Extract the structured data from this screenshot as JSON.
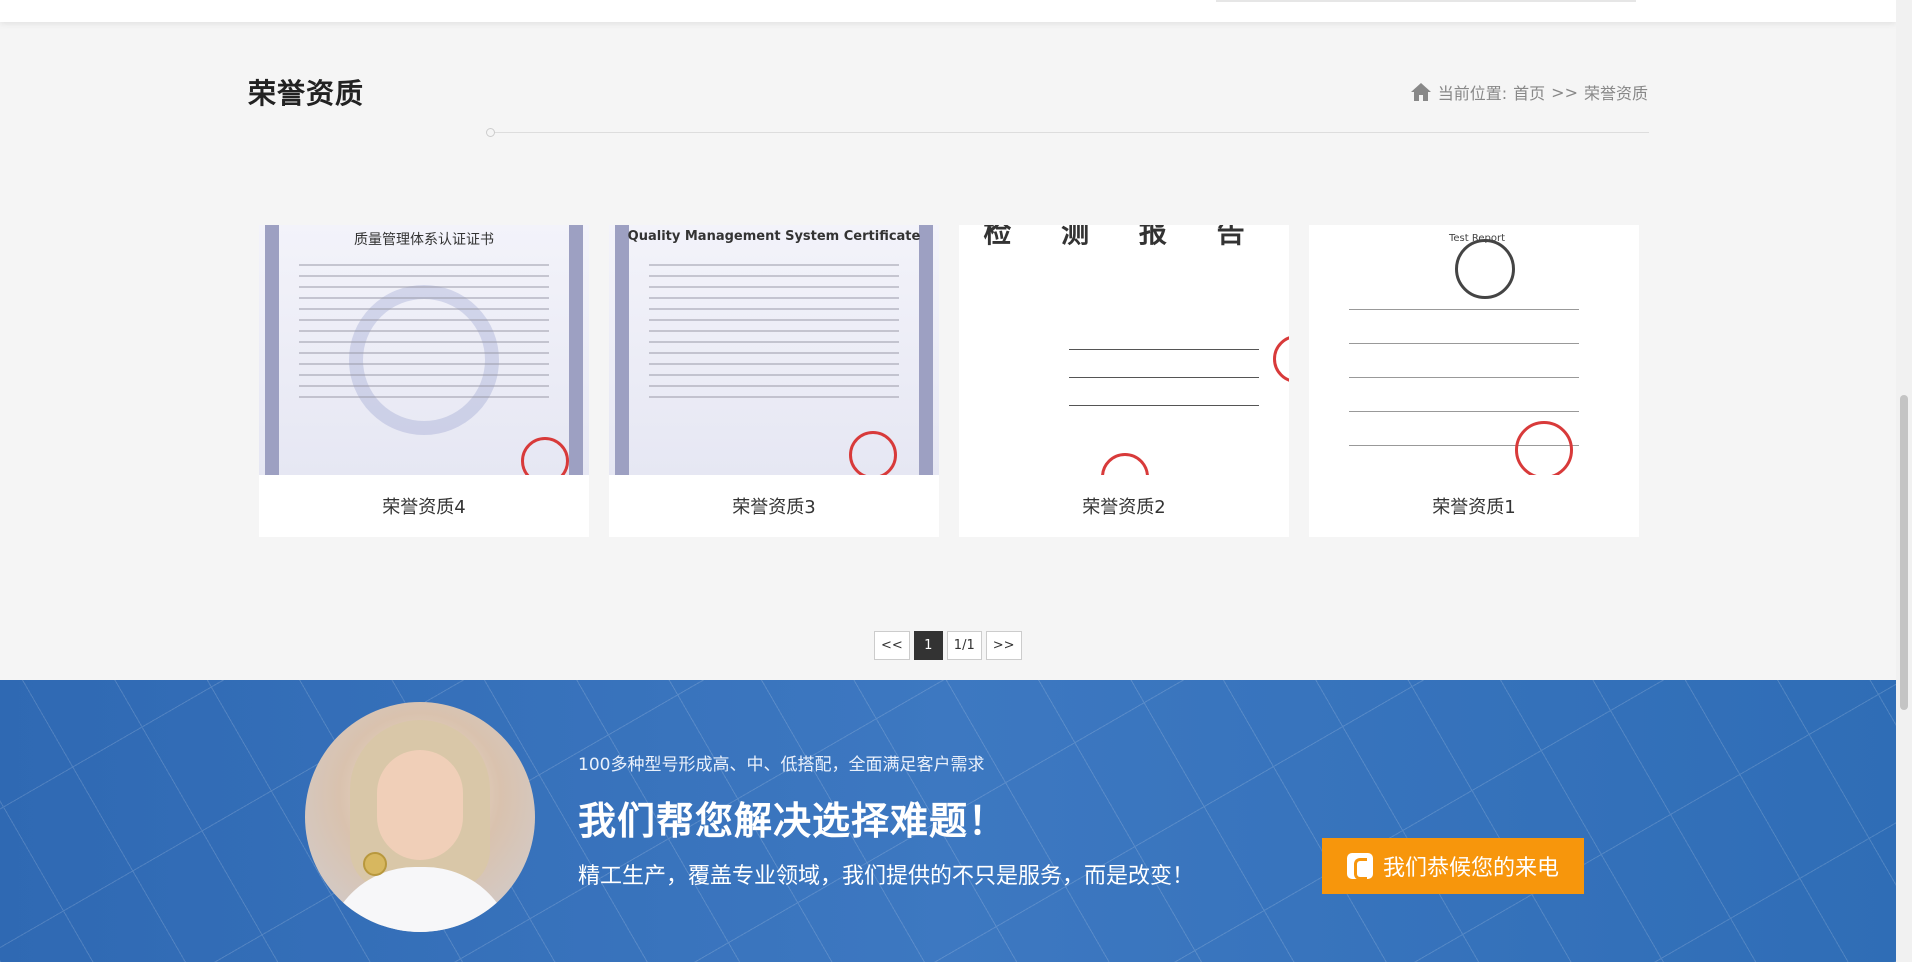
{
  "page": {
    "title": "荣誉资质"
  },
  "breadcrumb": {
    "prefix": "当前位置:",
    "home": "首页",
    "separator": ">>",
    "current": "荣誉资质"
  },
  "cards": [
    {
      "caption": "荣誉资质4",
      "heading": "质量管理体系认证证书"
    },
    {
      "caption": "荣誉资质3",
      "heading": "Quality Management System Certificate"
    },
    {
      "caption": "荣誉资质2",
      "heading": "检 测 报 告"
    },
    {
      "caption": "荣誉资质1",
      "heading": "Test Report"
    }
  ],
  "pagination": {
    "prev": "<<",
    "current": "1",
    "total": "1/1",
    "next": ">>"
  },
  "banner": {
    "subtitle": "100多种型号形成高、中、低搭配，全面满足客户需求",
    "headline": "我们帮您解决选择难题！",
    "description": "精工生产，覆盖专业领域，我们提供的不只是服务，而是改变！",
    "cta_label": "我们恭候您的来电"
  },
  "colors": {
    "accent": "#f7960c",
    "banner_blue": "#3d78c1"
  }
}
